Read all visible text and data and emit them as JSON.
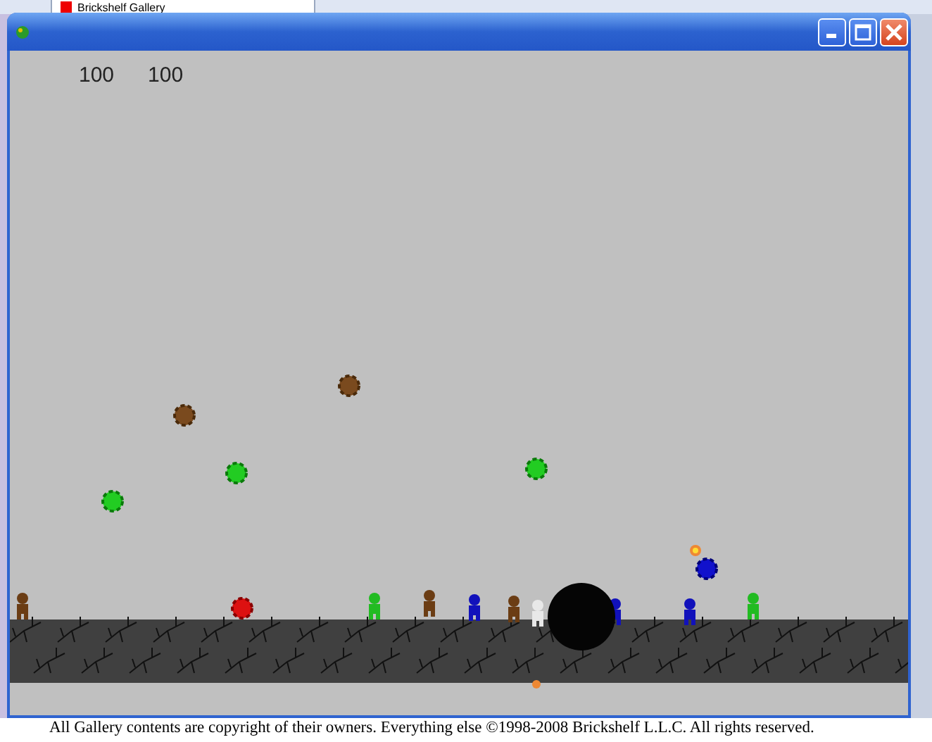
{
  "browser_tab": {
    "label": "Brickshelf Gallery"
  },
  "window": {
    "buttons": [
      {
        "kind": "minimize"
      },
      {
        "kind": "maximize"
      },
      {
        "kind": "close"
      }
    ]
  },
  "scores": [
    "100",
    "100"
  ],
  "footer": "All Gallery contents are copyright of their owners. Everything else ©1998-2008 Brickshelf L.L.C. All rights reserved."
}
